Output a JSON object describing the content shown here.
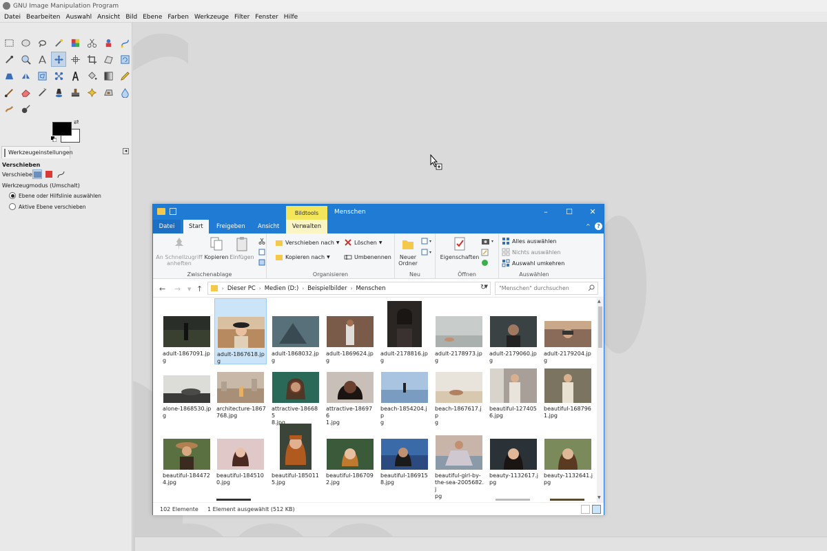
{
  "gimp": {
    "title": "GNU Image Manipulation Program",
    "menu": [
      "Datei",
      "Bearbeiten",
      "Auswahl",
      "Ansicht",
      "Bild",
      "Ebene",
      "Farben",
      "Werkzeuge",
      "Filter",
      "Fenster",
      "Hilfe"
    ],
    "tool_options": {
      "tab_label": "Werkzeugeinstellungen",
      "title": "Verschieben",
      "move_label": "Verschieben:",
      "mode_label": "Werkzeugmodus (Umschalt)",
      "option_1": "Ebene oder Hilfslinie auswählen",
      "option_2": "Aktive Ebene verschieben"
    },
    "colors": {
      "foreground": "#000000",
      "background": "#ffffff"
    }
  },
  "explorer": {
    "tools_tab": "Bildtools",
    "title": "Menschen",
    "tabs": {
      "file": "Datei",
      "start": "Start",
      "share": "Freigeben",
      "view": "Ansicht",
      "manage": "Verwalten"
    },
    "ribbon": {
      "pin_line1": "An Schnellzugriff",
      "pin_line2": "anheften",
      "copy": "Kopieren",
      "paste": "Einfügen",
      "group_clipboard": "Zwischenablage",
      "move_to": "Verschieben nach",
      "copy_to": "Kopieren nach",
      "delete": "Löschen",
      "rename": "Umbenennen",
      "group_organize": "Organisieren",
      "new_folder_line1": "Neuer",
      "new_folder_line2": "Ordner",
      "group_new": "Neu",
      "properties": "Eigenschaften",
      "group_open": "Öffnen",
      "select_all": "Alles auswählen",
      "select_none": "Nichts auswählen",
      "invert_selection": "Auswahl umkehren",
      "group_select": "Auswählen"
    },
    "address": [
      "Dieser PC",
      "Medien (D:)",
      "Beispielbilder",
      "Menschen"
    ],
    "search_placeholder": "\"Menschen\" durchsuchen",
    "files": [
      {
        "l1": "adult-1867091.jp",
        "l2": "g"
      },
      {
        "l1": "adult-1867618.jp",
        "l2": "g"
      },
      {
        "l1": "adult-1868032.jp",
        "l2": "g"
      },
      {
        "l1": "adult-1869624.jp",
        "l2": "g"
      },
      {
        "l1": "adult-2178816.jp",
        "l2": "g"
      },
      {
        "l1": "adult-2178973.jp",
        "l2": "g"
      },
      {
        "l1": "adult-2179060.jp",
        "l2": "g"
      },
      {
        "l1": "adult-2179204.jp",
        "l2": "g"
      },
      {
        "l1": "alone-1868530.jp",
        "l2": "g"
      },
      {
        "l1": "architecture-1867",
        "l2": "768.jpg"
      },
      {
        "l1": "attractive-186685",
        "l2": "8.jpg"
      },
      {
        "l1": "attractive-186976",
        "l2": "1.jpg"
      },
      {
        "l1": "beach-1854204.jp",
        "l2": "g"
      },
      {
        "l1": "beach-1867617.jp",
        "l2": "g"
      },
      {
        "l1": "beautiful-127405",
        "l2": "6.jpg"
      },
      {
        "l1": "beautiful-168796",
        "l2": "1.jpg"
      },
      {
        "l1": "beautiful-184472",
        "l2": "4.jpg"
      },
      {
        "l1": "beautiful-184510",
        "l2": "0.jpg"
      },
      {
        "l1": "beautiful-185011",
        "l2": "5.jpg"
      },
      {
        "l1": "beautiful-186709",
        "l2": "2.jpg"
      },
      {
        "l1": "beautiful-186915",
        "l2": "8.jpg"
      },
      {
        "l1": "beautiful-girl-by-",
        "l2": "the-sea-2005682.j",
        "l3": "pg"
      },
      {
        "l1": "beauty-1132617.j",
        "l2": "pg"
      },
      {
        "l1": "beauty-1132641.j",
        "l2": "pg"
      }
    ],
    "status_count": "102 Elemente",
    "status_selected": "1 Element ausgewählt (512 KB)"
  }
}
